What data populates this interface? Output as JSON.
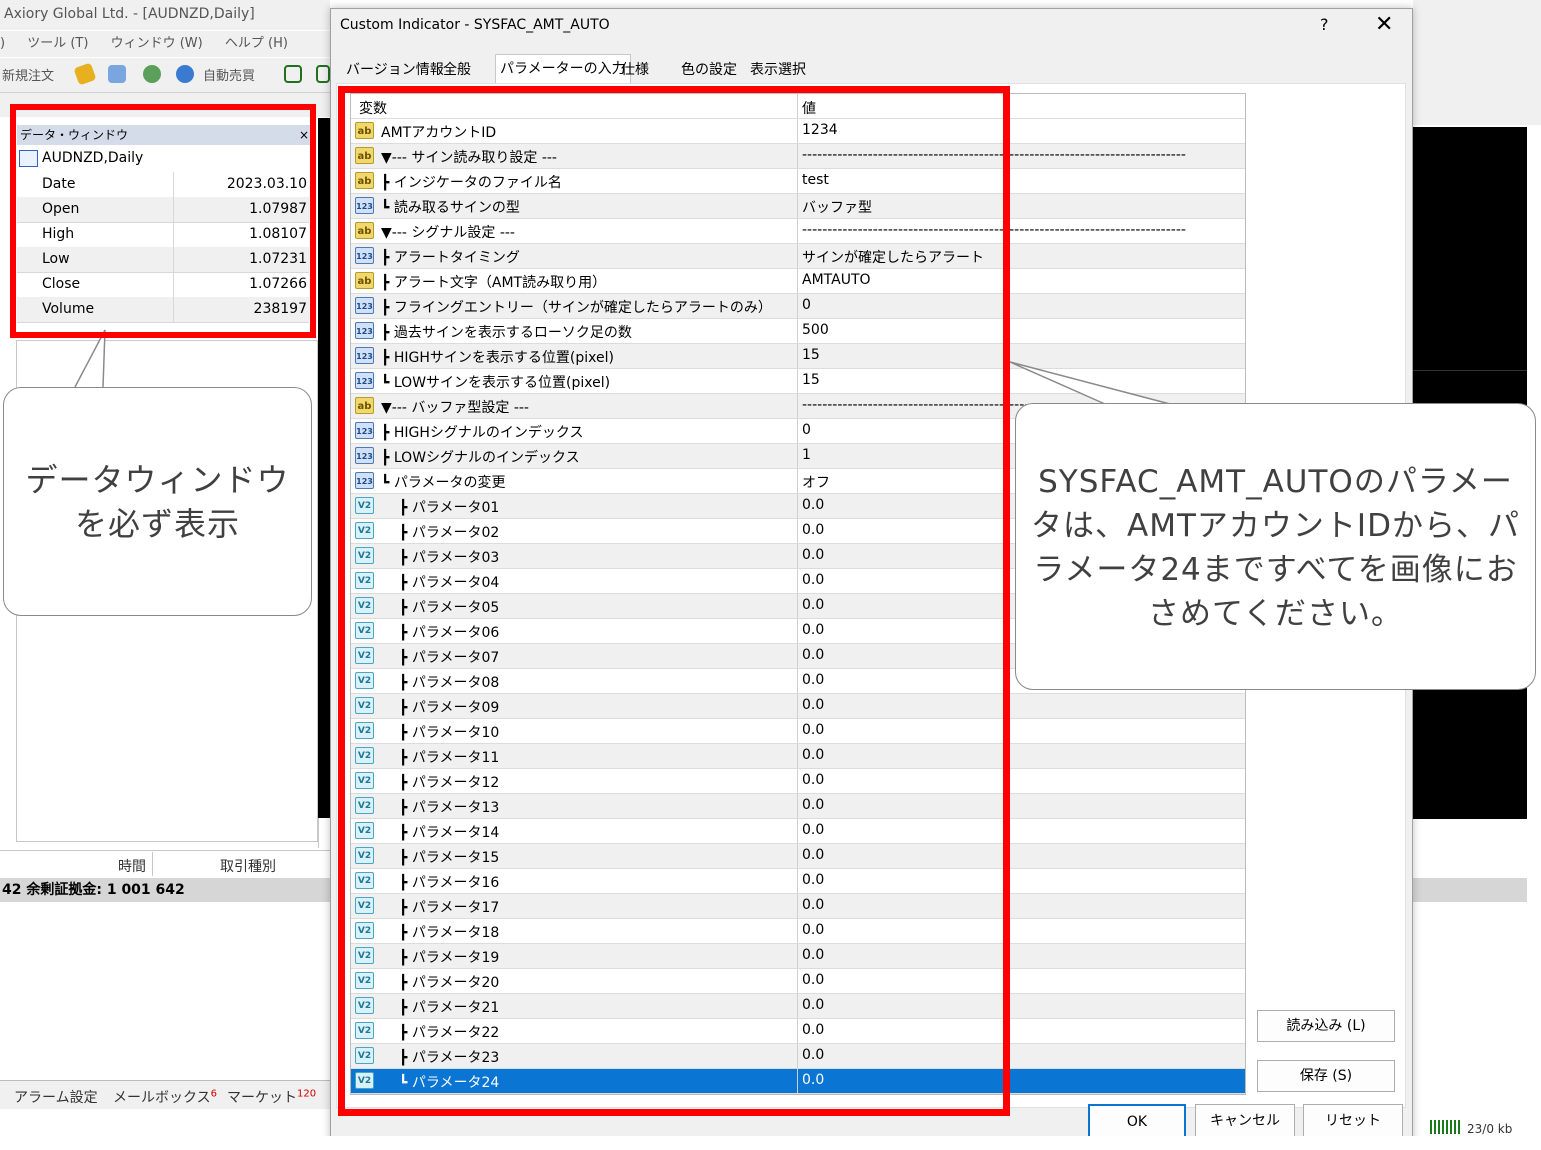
{
  "background_app": {
    "title": "Axiory Global Ltd. - [AUDNZD,Daily]",
    "menu": [
      "ツール (T)",
      "ウィンドウ (W)",
      "ヘルプ (H)"
    ],
    "menu_prefix": ")",
    "toolbar": {
      "new_order": "新規注文",
      "auto_trade": "自動売買"
    }
  },
  "data_window": {
    "title": "データ・ウィンドウ",
    "close": "×",
    "symbol": "AUDNZD,Daily",
    "rows": [
      {
        "label": "Date",
        "value": "2023.03.10"
      },
      {
        "label": "Open",
        "value": "1.07987"
      },
      {
        "label": "High",
        "value": "1.08107"
      },
      {
        "label": "Low",
        "value": "1.07231"
      },
      {
        "label": "Close",
        "value": "1.07266"
      },
      {
        "label": "Volume",
        "value": "238197"
      }
    ]
  },
  "terminal": {
    "col_time": "時間",
    "col_type": "取引種別",
    "balance": "42  余剰証拠金: 1 001 642",
    "tabs": [
      {
        "label": "アラーム設定",
        "badge": ""
      },
      {
        "label": "メールボックス",
        "badge": "6"
      },
      {
        "label": "マーケット",
        "badge": "120"
      }
    ],
    "status_size": "23/0 kb"
  },
  "callouts": {
    "left": "データウィンドウ\nを必ず表示",
    "right": "SYSFAC_AMT_AUTOのパラメータは、AMTアカウントIDから、パラメータ24まですべてを画像におさめてください。"
  },
  "dialog": {
    "title": "Custom Indicator - SYSFAC_AMT_AUTO",
    "help": "?",
    "close": "✕",
    "tabs": [
      "バージョン情報",
      "全般",
      "パラメーターの入力",
      "仕様",
      "色の設定",
      "表示選択"
    ],
    "active_tab": "パラメーターの入力",
    "grid_headers": {
      "name": "変数",
      "value": "値"
    },
    "params": [
      {
        "icon": "ab",
        "name": "AMTアカウントID",
        "value": "1234"
      },
      {
        "icon": "ab",
        "name": "▼--- サイン読み取り設定 ---",
        "value": "----------------------------------------------------------------------------"
      },
      {
        "icon": "ab",
        "name": "┣ インジケータのファイル名",
        "value": "test"
      },
      {
        "icon": "123",
        "name": "┗ 読み取るサインの型",
        "value": "バッファ型"
      },
      {
        "icon": "ab",
        "name": "▼--- シグナル設定 ---",
        "value": "----------------------------------------------------------------------------"
      },
      {
        "icon": "123",
        "name": "┣ アラートタイミング",
        "value": "サインが確定したらアラート"
      },
      {
        "icon": "ab",
        "name": "┣ アラート文字（AMT読み取り用）",
        "value": "AMTAUTO"
      },
      {
        "icon": "123",
        "name": "┣ フライングエントリー（サインが確定したらアラートのみ）",
        "value": "0"
      },
      {
        "icon": "123",
        "name": "┣ 過去サインを表示するローソク足の数",
        "value": "500"
      },
      {
        "icon": "123",
        "name": "┣ HIGHサインを表示する位置(pixel)",
        "value": "15"
      },
      {
        "icon": "123",
        "name": "┗ LOWサインを表示する位置(pixel)",
        "value": "15"
      },
      {
        "icon": "ab",
        "name": "▼--- バッファ型設定 ---",
        "value": "----------------------------------------------------------------------------"
      },
      {
        "icon": "123",
        "name": "┣ HIGHシグナルのインデックス",
        "value": "0"
      },
      {
        "icon": "123",
        "name": "┣ LOWシグナルのインデックス",
        "value": "1"
      },
      {
        "icon": "123",
        "name": "┗ パラメータの変更",
        "value": "オフ"
      },
      {
        "icon": "v2",
        "name": "┣ パラメータ01",
        "value": "0.0",
        "indent": true
      },
      {
        "icon": "v2",
        "name": "┣ パラメータ02",
        "value": "0.0",
        "indent": true
      },
      {
        "icon": "v2",
        "name": "┣ パラメータ03",
        "value": "0.0",
        "indent": true
      },
      {
        "icon": "v2",
        "name": "┣ パラメータ04",
        "value": "0.0",
        "indent": true
      },
      {
        "icon": "v2",
        "name": "┣ パラメータ05",
        "value": "0.0",
        "indent": true
      },
      {
        "icon": "v2",
        "name": "┣ パラメータ06",
        "value": "0.0",
        "indent": true
      },
      {
        "icon": "v2",
        "name": "┣ パラメータ07",
        "value": "0.0",
        "indent": true
      },
      {
        "icon": "v2",
        "name": "┣ パラメータ08",
        "value": "0.0",
        "indent": true
      },
      {
        "icon": "v2",
        "name": "┣ パラメータ09",
        "value": "0.0",
        "indent": true
      },
      {
        "icon": "v2",
        "name": "┣ パラメータ10",
        "value": "0.0",
        "indent": true
      },
      {
        "icon": "v2",
        "name": "┣ パラメータ11",
        "value": "0.0",
        "indent": true
      },
      {
        "icon": "v2",
        "name": "┣ パラメータ12",
        "value": "0.0",
        "indent": true
      },
      {
        "icon": "v2",
        "name": "┣ パラメータ13",
        "value": "0.0",
        "indent": true
      },
      {
        "icon": "v2",
        "name": "┣ パラメータ14",
        "value": "0.0",
        "indent": true
      },
      {
        "icon": "v2",
        "name": "┣ パラメータ15",
        "value": "0.0",
        "indent": true
      },
      {
        "icon": "v2",
        "name": "┣ パラメータ16",
        "value": "0.0",
        "indent": true
      },
      {
        "icon": "v2",
        "name": "┣ パラメータ17",
        "value": "0.0",
        "indent": true
      },
      {
        "icon": "v2",
        "name": "┣ パラメータ18",
        "value": "0.0",
        "indent": true
      },
      {
        "icon": "v2",
        "name": "┣ パラメータ19",
        "value": "0.0",
        "indent": true
      },
      {
        "icon": "v2",
        "name": "┣ パラメータ20",
        "value": "0.0",
        "indent": true
      },
      {
        "icon": "v2",
        "name": "┣ パラメータ21",
        "value": "0.0",
        "indent": true
      },
      {
        "icon": "v2",
        "name": "┣ パラメータ22",
        "value": "0.0",
        "indent": true
      },
      {
        "icon": "v2",
        "name": "┣ パラメータ23",
        "value": "0.0",
        "indent": true
      },
      {
        "icon": "v2",
        "name": "┗ パラメータ24",
        "value": "0.0",
        "indent": true,
        "selected": true
      }
    ],
    "buttons": {
      "load": "読み込み (L)",
      "save": "保存 (S)",
      "ok": "OK",
      "cancel": "キャンセル",
      "reset": "リセット"
    }
  },
  "colors": {
    "highlight_red": "#ff0000",
    "selection_blue": "#0a75d3"
  }
}
